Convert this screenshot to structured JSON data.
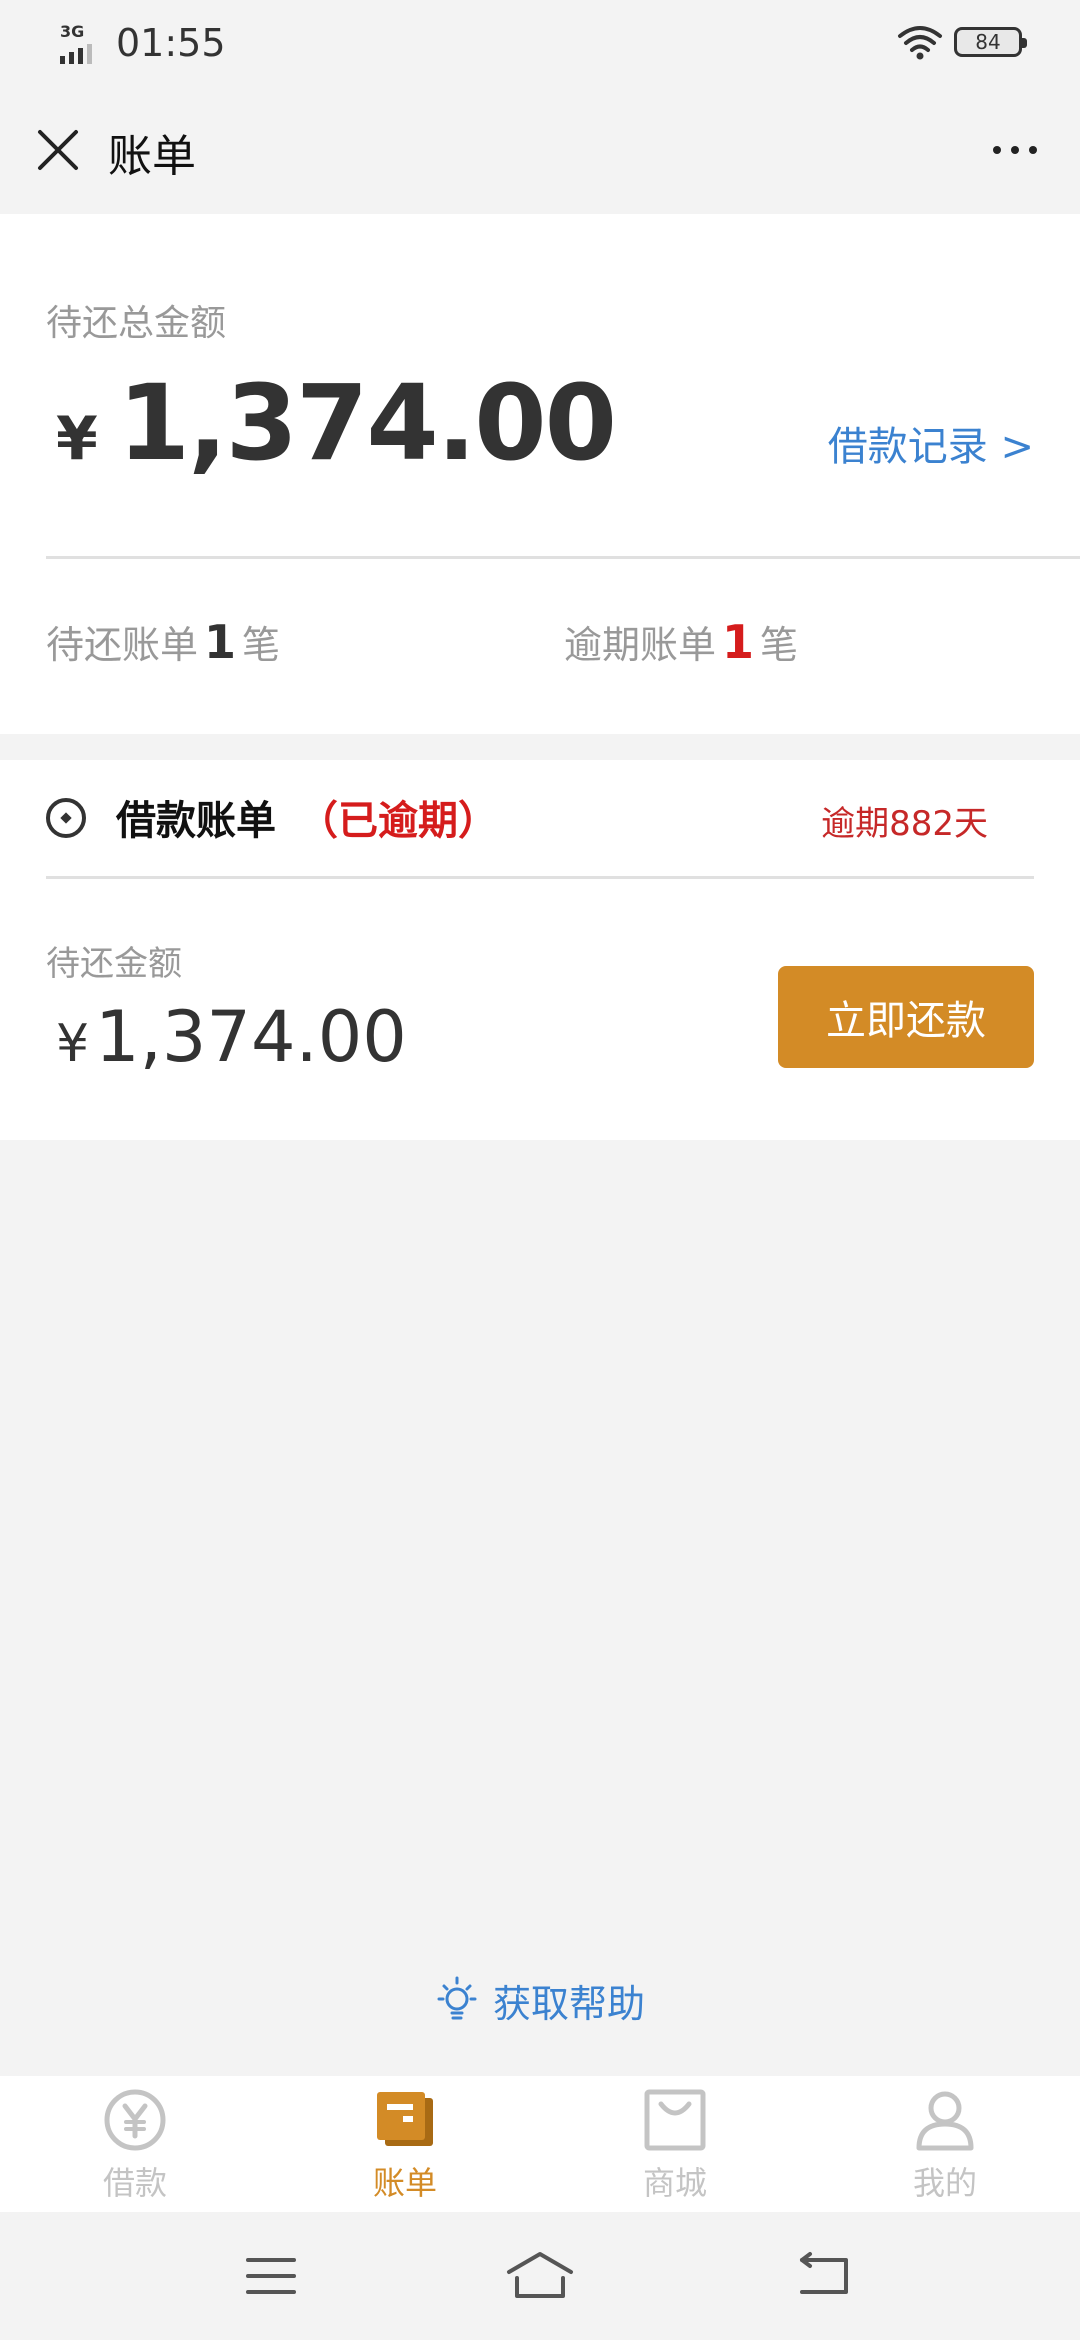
{
  "status_bar": {
    "network": "3G",
    "time": "01:55",
    "battery": "84"
  },
  "title_bar": {
    "title": "账单"
  },
  "summary": {
    "total_label": "待还总金额",
    "currency": "¥",
    "total_amount": "1,374.00",
    "loan_records_link": "借款记录 >",
    "pending_bills": {
      "prefix": "待还账单",
      "count": "1",
      "suffix": "笔"
    },
    "overdue_bills": {
      "prefix": "逾期账单",
      "count": "1",
      "suffix": "笔"
    }
  },
  "bill": {
    "title": "借款账单",
    "status": "（已逾期）",
    "overdue_days": "逾期882天",
    "pending_label": "待还金额",
    "currency": "¥",
    "amount": "1,374.00",
    "pay_button": "立即还款"
  },
  "help": {
    "label": "获取帮助"
  },
  "tabs": [
    {
      "label": "借款",
      "icon": "yen-coin-icon",
      "active": false
    },
    {
      "label": "账单",
      "icon": "bill-icon",
      "active": true
    },
    {
      "label": "商城",
      "icon": "shopping-bag-icon",
      "active": false
    },
    {
      "label": "我的",
      "icon": "person-icon",
      "active": false
    }
  ],
  "colors": {
    "accent": "#d38b26",
    "link": "#3b82d0",
    "danger": "#d51c1c",
    "inactive": "#c4c4c4"
  }
}
